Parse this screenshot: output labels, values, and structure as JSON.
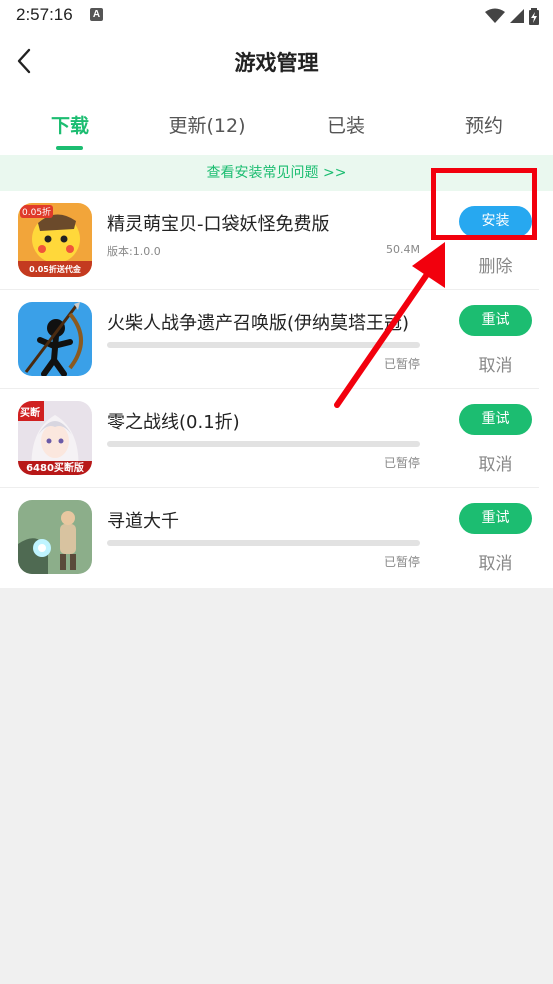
{
  "status_bar": {
    "time": "2:57:16",
    "notification": "A"
  },
  "header": {
    "title": "游戏管理"
  },
  "tabs": [
    {
      "label": "下载",
      "active": true
    },
    {
      "label": "更新(12)",
      "active": false
    },
    {
      "label": "已装",
      "active": false
    },
    {
      "label": "预约",
      "active": false
    }
  ],
  "faq_link": "查看安装常见问题 >>",
  "items": [
    {
      "name": "精灵萌宝贝-口袋妖怪免费版",
      "version": "版本:1.0.0",
      "size": "50.4M",
      "action": "安装",
      "secondary": "删除",
      "icon_label": "0.05折",
      "icon_caption": "0.05折送代金"
    },
    {
      "name": "火柴人战争遗产召唤版(伊纳莫塔王冠)",
      "status": "已暂停",
      "progress": 0,
      "action": "重试",
      "secondary": "取消"
    },
    {
      "name": "零之战线(0.1折)",
      "status": "已暂停",
      "progress": 0,
      "action": "重试",
      "secondary": "取消",
      "icon_label": "买断",
      "icon_caption": "6480买断版"
    },
    {
      "name": "寻道大千",
      "status": "已暂停",
      "progress": 0,
      "action": "重试",
      "secondary": "取消"
    }
  ],
  "colors": {
    "accent": "#1cbd71",
    "install": "#27a8f0",
    "annotation": "#f2000d"
  }
}
